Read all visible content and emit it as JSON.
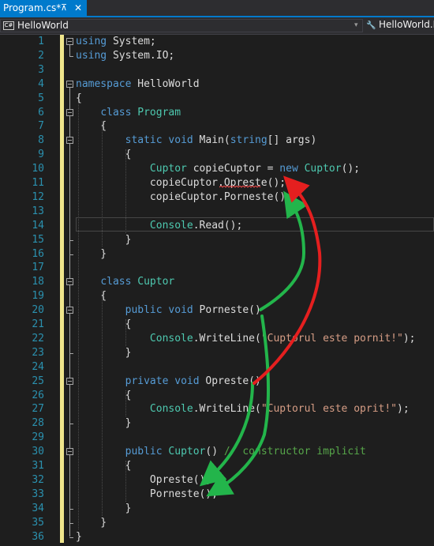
{
  "tab": {
    "title": "Program.cs*",
    "pin": "⊼",
    "close": "✕"
  },
  "nav": {
    "project_icon": "C#",
    "project": "HelloWorld",
    "dropdown": "▾",
    "right_icon": "🔧",
    "right": "HelloWorld.Program"
  },
  "colors": {
    "keyword": "#569cd6",
    "type": "#4ec9b0",
    "string": "#d69d85",
    "comment": "#57a64a",
    "line_number": "#2b91af",
    "change_bar": "#f0e68c",
    "arrow_red": "#e51f1f",
    "arrow_green": "#23b54b"
  },
  "lines": [
    {
      "n": "1",
      "t": [
        {
          "c": "kw",
          "s": "using"
        },
        {
          "c": "pl",
          "s": " System;"
        }
      ]
    },
    {
      "n": "2",
      "t": [
        {
          "c": "kw",
          "s": "using"
        },
        {
          "c": "pl",
          "s": " System.IO;"
        }
      ]
    },
    {
      "n": "3",
      "t": []
    },
    {
      "n": "4",
      "t": [
        {
          "c": "kw",
          "s": "namespace"
        },
        {
          "c": "pl",
          "s": " HelloWorld"
        }
      ]
    },
    {
      "n": "5",
      "t": [
        {
          "c": "pl",
          "s": "{"
        }
      ]
    },
    {
      "n": "6",
      "t": [
        {
          "c": "pl",
          "s": "    "
        },
        {
          "c": "kw",
          "s": "class"
        },
        {
          "c": "pl",
          "s": " "
        },
        {
          "c": "ty",
          "s": "Program"
        }
      ]
    },
    {
      "n": "7",
      "t": [
        {
          "c": "pl",
          "s": "    {"
        }
      ]
    },
    {
      "n": "8",
      "t": [
        {
          "c": "pl",
          "s": "        "
        },
        {
          "c": "kw",
          "s": "static"
        },
        {
          "c": "pl",
          "s": " "
        },
        {
          "c": "kw",
          "s": "void"
        },
        {
          "c": "pl",
          "s": " Main("
        },
        {
          "c": "kw",
          "s": "string"
        },
        {
          "c": "pl",
          "s": "[] args)"
        }
      ]
    },
    {
      "n": "9",
      "t": [
        {
          "c": "pl",
          "s": "        {"
        }
      ]
    },
    {
      "n": "10",
      "t": [
        {
          "c": "pl",
          "s": "            "
        },
        {
          "c": "ty",
          "s": "Cuptor"
        },
        {
          "c": "pl",
          "s": " copieCuptor = "
        },
        {
          "c": "kw",
          "s": "new"
        },
        {
          "c": "pl",
          "s": " "
        },
        {
          "c": "ty",
          "s": "Cuptor"
        },
        {
          "c": "pl",
          "s": "();"
        }
      ]
    },
    {
      "n": "11",
      "t": [
        {
          "c": "pl",
          "s": "            copieCuptor.Opreste();"
        }
      ]
    },
    {
      "n": "12",
      "t": [
        {
          "c": "pl",
          "s": "            copieCuptor.Porneste();"
        }
      ]
    },
    {
      "n": "13",
      "t": []
    },
    {
      "n": "14",
      "t": [
        {
          "c": "pl",
          "s": "            "
        },
        {
          "c": "ty",
          "s": "Console"
        },
        {
          "c": "pl",
          "s": ".Read();"
        }
      ]
    },
    {
      "n": "15",
      "t": [
        {
          "c": "pl",
          "s": "        }"
        }
      ]
    },
    {
      "n": "16",
      "t": [
        {
          "c": "pl",
          "s": "    }"
        }
      ]
    },
    {
      "n": "17",
      "t": []
    },
    {
      "n": "18",
      "t": [
        {
          "c": "pl",
          "s": "    "
        },
        {
          "c": "kw",
          "s": "class"
        },
        {
          "c": "pl",
          "s": " "
        },
        {
          "c": "ty",
          "s": "Cuptor"
        }
      ]
    },
    {
      "n": "19",
      "t": [
        {
          "c": "pl",
          "s": "    {"
        }
      ]
    },
    {
      "n": "20",
      "t": [
        {
          "c": "pl",
          "s": "        "
        },
        {
          "c": "kw",
          "s": "public"
        },
        {
          "c": "pl",
          "s": " "
        },
        {
          "c": "kw",
          "s": "void"
        },
        {
          "c": "pl",
          "s": " Porneste()"
        }
      ]
    },
    {
      "n": "21",
      "t": [
        {
          "c": "pl",
          "s": "        {"
        }
      ]
    },
    {
      "n": "22",
      "t": [
        {
          "c": "pl",
          "s": "            "
        },
        {
          "c": "ty",
          "s": "Console"
        },
        {
          "c": "pl",
          "s": ".WriteLine("
        },
        {
          "c": "st",
          "s": "\"Cuptorul este pornit!\""
        },
        {
          "c": "pl",
          "s": ");"
        }
      ]
    },
    {
      "n": "23",
      "t": [
        {
          "c": "pl",
          "s": "        }"
        }
      ]
    },
    {
      "n": "24",
      "t": []
    },
    {
      "n": "25",
      "t": [
        {
          "c": "pl",
          "s": "        "
        },
        {
          "c": "kw",
          "s": "private"
        },
        {
          "c": "pl",
          "s": " "
        },
        {
          "c": "kw",
          "s": "void"
        },
        {
          "c": "pl",
          "s": " Opreste()"
        }
      ]
    },
    {
      "n": "26",
      "t": [
        {
          "c": "pl",
          "s": "        {"
        }
      ]
    },
    {
      "n": "27",
      "t": [
        {
          "c": "pl",
          "s": "            "
        },
        {
          "c": "ty",
          "s": "Console"
        },
        {
          "c": "pl",
          "s": ".WriteLine("
        },
        {
          "c": "st",
          "s": "\"Cuptorul este oprit!\""
        },
        {
          "c": "pl",
          "s": ");"
        }
      ]
    },
    {
      "n": "28",
      "t": [
        {
          "c": "pl",
          "s": "        }"
        }
      ]
    },
    {
      "n": "29",
      "t": []
    },
    {
      "n": "30",
      "t": [
        {
          "c": "pl",
          "s": "        "
        },
        {
          "c": "kw",
          "s": "public"
        },
        {
          "c": "pl",
          "s": " "
        },
        {
          "c": "ty",
          "s": "Cuptor"
        },
        {
          "c": "pl",
          "s": "() "
        },
        {
          "c": "cm",
          "s": "// constructor implicit"
        }
      ]
    },
    {
      "n": "31",
      "t": [
        {
          "c": "pl",
          "s": "        {"
        }
      ]
    },
    {
      "n": "32",
      "t": [
        {
          "c": "pl",
          "s": "            Opreste();"
        }
      ]
    },
    {
      "n": "33",
      "t": [
        {
          "c": "pl",
          "s": "            Porneste();"
        }
      ]
    },
    {
      "n": "34",
      "t": [
        {
          "c": "pl",
          "s": "        }"
        }
      ]
    },
    {
      "n": "35",
      "t": [
        {
          "c": "pl",
          "s": "    }"
        }
      ]
    },
    {
      "n": "36",
      "t": [
        {
          "c": "pl",
          "s": "}"
        }
      ]
    }
  ]
}
